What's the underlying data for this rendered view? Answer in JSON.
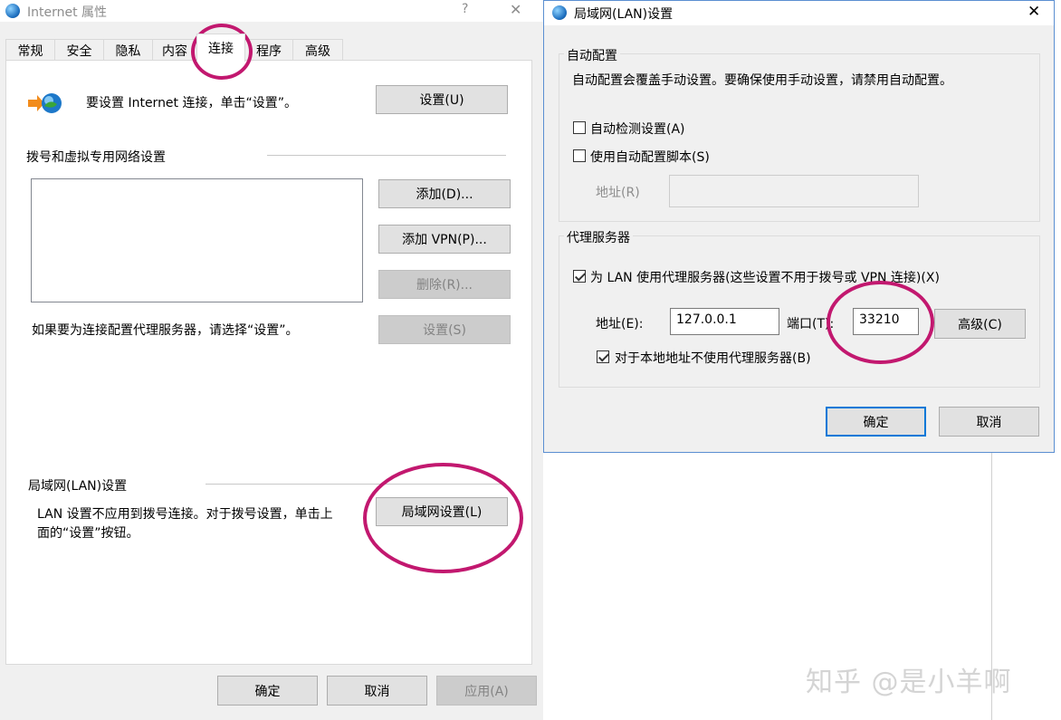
{
  "inet_dialog": {
    "title": "Internet 属性",
    "help": "?",
    "close": "✕",
    "tabs": [
      "常规",
      "安全",
      "隐私",
      "内容",
      "连接",
      "程序",
      "高级"
    ],
    "setup_text": "要设置 Internet 连接，单击“设置”。",
    "setup_button": "设置(U)",
    "dialup_section": "拨号和虚拟专用网络设置",
    "add_button": "添加(D)...",
    "add_vpn_button": "添加 VPN(P)...",
    "remove_button": "删除(R)...",
    "proxy_hint": "如果要为连接配置代理服务器，请选择“设置”。",
    "settings_button": "设置(S)",
    "lan_section": "局域网(LAN)设置",
    "lan_text_line1": "LAN 设置不应用到拨号连接。对于拨号设置，单击上",
    "lan_text_line2": "面的“设置”按钮。",
    "lan_settings_button": "局域网设置(L)",
    "ok": "确定",
    "cancel": "取消",
    "apply": "应用(A)"
  },
  "lan_dialog": {
    "title": "局域网(LAN)设置",
    "close": "✕",
    "auto_config_group": "自动配置",
    "auto_config_desc": "自动配置会覆盖手动设置。要确保使用手动设置，请禁用自动配置。",
    "auto_detect_label": "自动检测设置(A)",
    "auto_detect_checked": false,
    "use_script_label": "使用自动配置脚本(S)",
    "use_script_checked": false,
    "script_address_label": "地址(R)",
    "script_address_value": "",
    "proxy_group": "代理服务器",
    "use_proxy_label": "为 LAN 使用代理服务器(这些设置不用于拨号或 VPN 连接)(X)",
    "use_proxy_checked": true,
    "address_label": "地址(E):",
    "address_value": "127.0.0.1",
    "port_label": "端口(T):",
    "port_value": "33210",
    "advanced_button": "高级(C)",
    "bypass_local_label": "对于本地地址不使用代理服务器(B)",
    "bypass_local_checked": true,
    "ok": "确定",
    "cancel": "取消"
  },
  "watermark": "知乎 @是小羊啊",
  "colors": {
    "highlight_circle": "#c2186f",
    "accent": "#0078d7"
  }
}
